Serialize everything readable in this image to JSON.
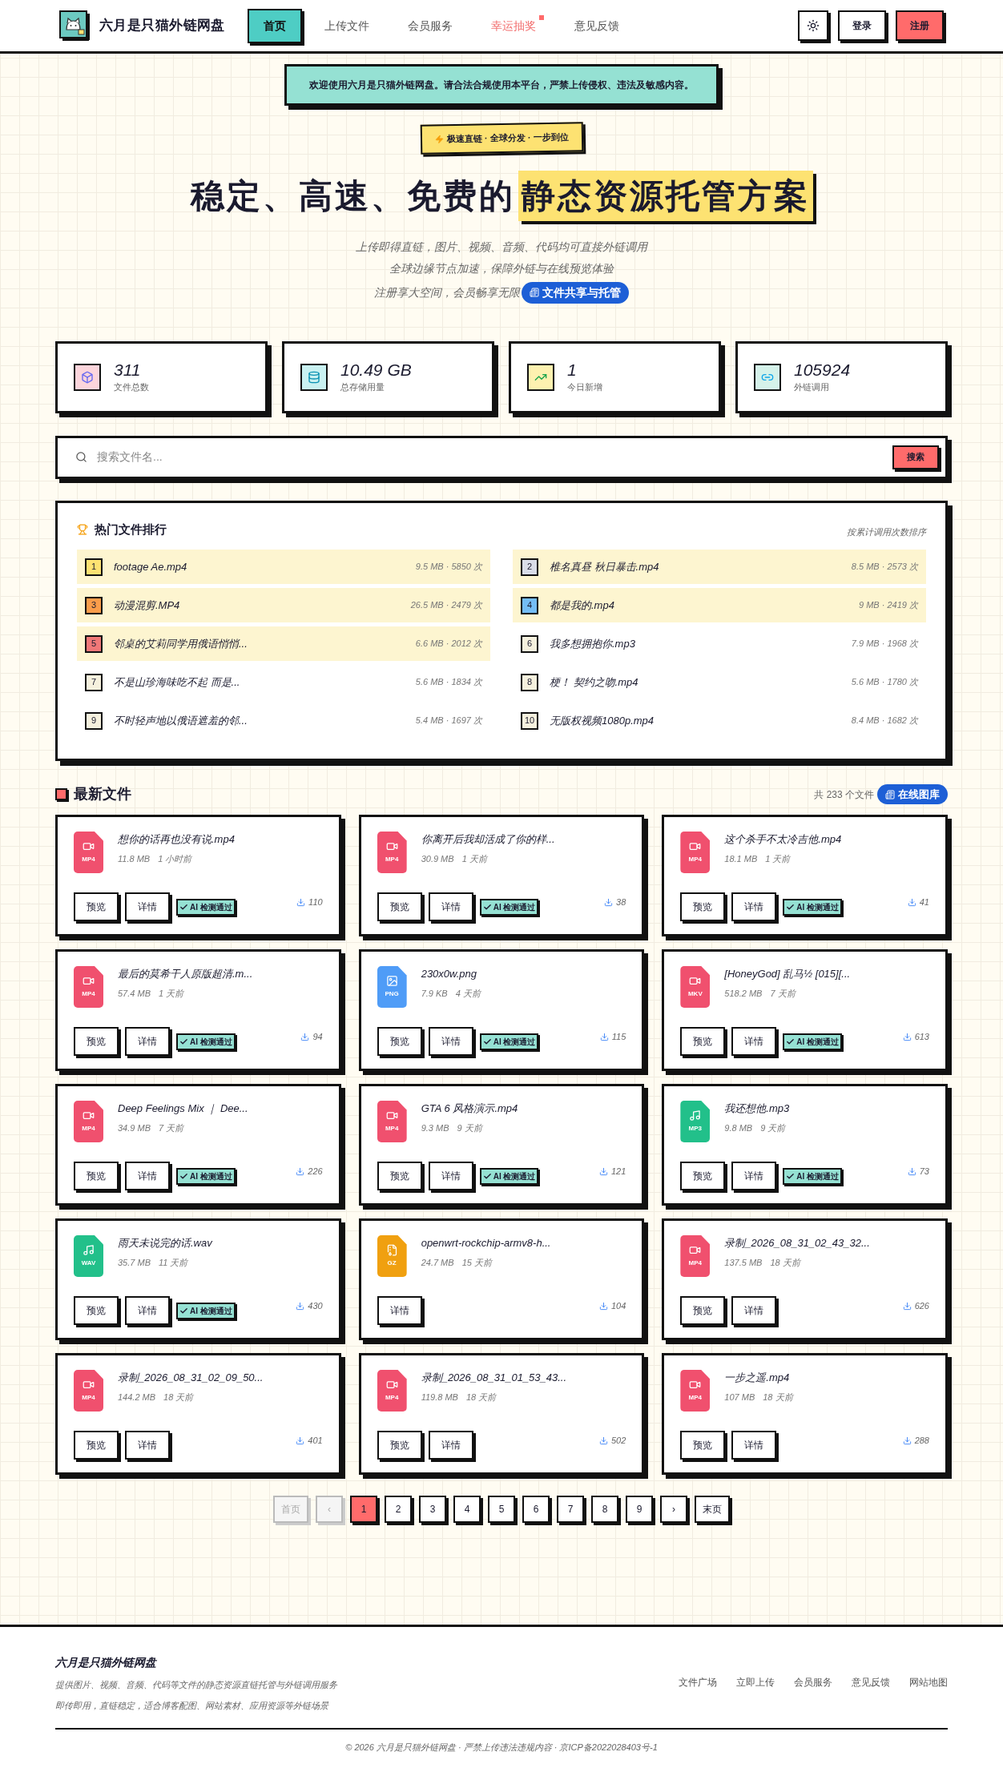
{
  "header": {
    "brand": "六月是只猫外链网盘",
    "links": [
      {
        "label": "首页",
        "selected": true,
        "kind": "normal"
      },
      {
        "label": "上传文件",
        "selected": false,
        "kind": "normal"
      },
      {
        "label": "会员服务",
        "selected": false,
        "kind": "normal"
      },
      {
        "label": "幸运抽奖",
        "selected": false,
        "kind": "hot"
      },
      {
        "label": "意见反馈",
        "selected": false,
        "kind": "normal"
      }
    ],
    "login": "登录",
    "register": "注册"
  },
  "notice": "欢迎使用六月是只猫外链网盘。请合法合规使用本平台，严禁上传侵权、违法及敏感内容。",
  "hero": {
    "badge": "极速直链 · 全球分发 · 一步到位",
    "title": "稳定、高速、免费的",
    "title_highlight": "静态资源托管方案",
    "lines": [
      "上传即得直链，图片、视频、音频、代码均可直接外链调用",
      "全球边缘节点加速，保障外链与在线预览体验",
      "注册享大空间，会员畅享无限"
    ],
    "pill": "文件共享与托管"
  },
  "stats": [
    {
      "value": "311",
      "label": "文件总数",
      "kind": "files",
      "color": "#fcd5dc"
    },
    {
      "value": "10.49 GB",
      "label": "总存储用量",
      "kind": "storage",
      "color": "#c9f1f1"
    },
    {
      "value": "1",
      "label": "今日新增",
      "kind": "trend",
      "color": "#fdf1b0"
    },
    {
      "value": "105924",
      "label": "外链调用",
      "kind": "link",
      "color": "#d5f2ea"
    }
  ],
  "search": {
    "placeholder": "搜索文件名...",
    "button": "搜索"
  },
  "hot": {
    "title": "热门文件排行",
    "note": "按累计调用次数排序",
    "items": [
      {
        "rank": "1",
        "name": "footage Ae.mp4",
        "meta": "9.5 MB · 5850 次",
        "highlighted": true,
        "color": "#fde272"
      },
      {
        "rank": "2",
        "name": "椎名真昼 秋日暴击.mp4",
        "meta": "8.5 MB · 2573 次",
        "highlighted": true,
        "color": "#d9dde8"
      },
      {
        "rank": "3",
        "name": "动漫混剪.MP4",
        "meta": "26.5 MB · 2479 次",
        "highlighted": true,
        "color": "#fb9d4a"
      },
      {
        "rank": "4",
        "name": "都是我的.mp4",
        "meta": "9 MB · 2419 次",
        "highlighted": true,
        "color": "#74bdf5"
      },
      {
        "rank": "5",
        "name": "邻桌的艾莉同学用俄语悄悄...",
        "meta": "6.6 MB · 2012 次",
        "highlighted": true,
        "color": "#f07878"
      },
      {
        "rank": "6",
        "name": "我多想拥抱你.mp3",
        "meta": "7.9 MB · 1968 次",
        "highlighted": false,
        "color": "#f6f1de"
      },
      {
        "rank": "7",
        "name": "不是山珍海味吃不起 而是...",
        "meta": "5.6 MB · 1834 次",
        "highlighted": false,
        "color": "#f6f1de"
      },
      {
        "rank": "8",
        "name": "梗！ 契约之吻.mp4",
        "meta": "5.6 MB · 1780 次",
        "highlighted": false,
        "color": "#f6f1de"
      },
      {
        "rank": "9",
        "name": "不时轻声地以俄语遮羞的邻...",
        "meta": "5.4 MB · 1697 次",
        "highlighted": false,
        "color": "#f6f1de"
      },
      {
        "rank": "10",
        "name": "无版权视频1080p.mp4",
        "meta": "8.4 MB · 1682 次",
        "highlighted": false,
        "color": "#f6f1de"
      }
    ]
  },
  "latest": {
    "title": "最新文件",
    "count": "共 233 个文件",
    "gallery": "在线图库",
    "files": [
      {
        "name": "想你的话再也没有说.mp4",
        "size": "11.8 MB",
        "time": "1 小时前",
        "ext": "MP4",
        "kind": "video",
        "color": "#f0506e",
        "downloads": "110",
        "actions": [
          "预览",
          "详情"
        ],
        "ai": "AI 检测通过"
      },
      {
        "name": "你离开后我却活成了你的样...",
        "size": "30.9 MB",
        "time": "1 天前",
        "ext": "MP4",
        "kind": "video",
        "color": "#f0506e",
        "downloads": "38",
        "actions": [
          "预览",
          "详情"
        ],
        "ai": "AI 检测通过"
      },
      {
        "name": "这个杀手不太冷吉他.mp4",
        "size": "18.1 MB",
        "time": "1 天前",
        "ext": "MP4",
        "kind": "video",
        "color": "#f0506e",
        "downloads": "41",
        "actions": [
          "预览",
          "详情"
        ],
        "ai": "AI 检测通过"
      },
      {
        "name": "最后的莫希干人原版超清.m...",
        "size": "57.4 MB",
        "time": "1 天前",
        "ext": "MP4",
        "kind": "video",
        "color": "#f0506e",
        "downloads": "94",
        "actions": [
          "预览",
          "详情"
        ],
        "ai": "AI 检测通过"
      },
      {
        "name": "230x0w.png",
        "size": "7.9 KB",
        "time": "4 天前",
        "ext": "PNG",
        "kind": "image",
        "color": "#4f9cf7",
        "downloads": "115",
        "actions": [
          "预览",
          "详情"
        ],
        "ai": "AI 检测通过"
      },
      {
        "name": "[HoneyGod] 乱马½ [015][...",
        "size": "518.2 MB",
        "time": "7 天前",
        "ext": "MKV",
        "kind": "video",
        "color": "#f0506e",
        "downloads": "613",
        "actions": [
          "预览",
          "详情"
        ],
        "ai": "AI 检测通过"
      },
      {
        "name": "Deep Feelings Mix ｜ Dee...",
        "size": "34.9 MB",
        "time": "7 天前",
        "ext": "MP4",
        "kind": "video",
        "color": "#f0506e",
        "downloads": "226",
        "actions": [
          "预览",
          "详情"
        ],
        "ai": "AI 检测通过"
      },
      {
        "name": "GTA 6 风格演示.mp4",
        "size": "9.3 MB",
        "time": "9 天前",
        "ext": "MP4",
        "kind": "video",
        "color": "#f0506e",
        "downloads": "121",
        "actions": [
          "预览",
          "详情"
        ],
        "ai": "AI 检测通过"
      },
      {
        "name": "我还想他.mp3",
        "size": "9.8 MB",
        "time": "9 天前",
        "ext": "MP3",
        "kind": "audio",
        "color": "#22c08a",
        "downloads": "73",
        "actions": [
          "预览",
          "详情"
        ],
        "ai": "AI 检测通过"
      },
      {
        "name": "雨天未说完的话.wav",
        "size": "35.7 MB",
        "time": "11 天前",
        "ext": "WAV",
        "kind": "audio",
        "color": "#22c08a",
        "downloads": "430",
        "actions": [
          "预览",
          "详情"
        ],
        "ai": "AI 检测通过"
      },
      {
        "name": "openwrt-rockchip-armv8-h...",
        "size": "24.7 MB",
        "time": "15 天前",
        "ext": "GZ",
        "kind": "archive",
        "color": "#f0a010",
        "downloads": "104",
        "actions": [
          "详情"
        ]
      },
      {
        "name": "录制_2026_08_31_02_43_32...",
        "size": "137.5 MB",
        "time": "18 天前",
        "ext": "MP4",
        "kind": "video",
        "color": "#f0506e",
        "downloads": "626",
        "actions": [
          "预览",
          "详情"
        ]
      },
      {
        "name": "录制_2026_08_31_02_09_50...",
        "size": "144.2 MB",
        "time": "18 天前",
        "ext": "MP4",
        "kind": "video",
        "color": "#f0506e",
        "downloads": "401",
        "actions": [
          "预览",
          "详情"
        ]
      },
      {
        "name": "录制_2026_08_31_01_53_43...",
        "size": "119.8 MB",
        "time": "18 天前",
        "ext": "MP4",
        "kind": "video",
        "color": "#f0506e",
        "downloads": "502",
        "actions": [
          "预览",
          "详情"
        ]
      },
      {
        "name": "一步之遥.mp4",
        "size": "107 MB",
        "time": "18 天前",
        "ext": "MP4",
        "kind": "video",
        "color": "#f0506e",
        "downloads": "288",
        "actions": [
          "预览",
          "详情"
        ]
      }
    ]
  },
  "pagination": [
    {
      "label": "首页",
      "selected": false,
      "disabled": true
    },
    {
      "label": "‹",
      "selected": false,
      "disabled": true
    },
    {
      "label": "1",
      "selected": true,
      "disabled": false
    },
    {
      "label": "2",
      "selected": false,
      "disabled": false
    },
    {
      "label": "3",
      "selected": false,
      "disabled": false
    },
    {
      "label": "4",
      "selected": false,
      "disabled": false
    },
    {
      "label": "5",
      "selected": false,
      "disabled": false
    },
    {
      "label": "6",
      "selected": false,
      "disabled": false
    },
    {
      "label": "7",
      "selected": false,
      "disabled": false
    },
    {
      "label": "8",
      "selected": false,
      "disabled": false
    },
    {
      "label": "9",
      "selected": false,
      "disabled": false
    },
    {
      "label": "›",
      "selected": false,
      "disabled": false
    },
    {
      "label": "末页",
      "selected": false,
      "disabled": false
    }
  ],
  "footer": {
    "brand": "六月是只猫外链网盘",
    "lines": [
      "提供图片、视频、音频、代码等文件的静态资源直链托管与外链调用服务",
      "即传即用，直链稳定，适合博客配图、网站素材、应用资源等外链场景"
    ],
    "links": [
      "文件广场",
      "立即上传",
      "会员服务",
      "意见反馈",
      "网站地图"
    ],
    "copyright": "© 2026 六月是只猫外链网盘 · 严禁上传违法违规内容 · 京ICP备2022028403号-1"
  }
}
